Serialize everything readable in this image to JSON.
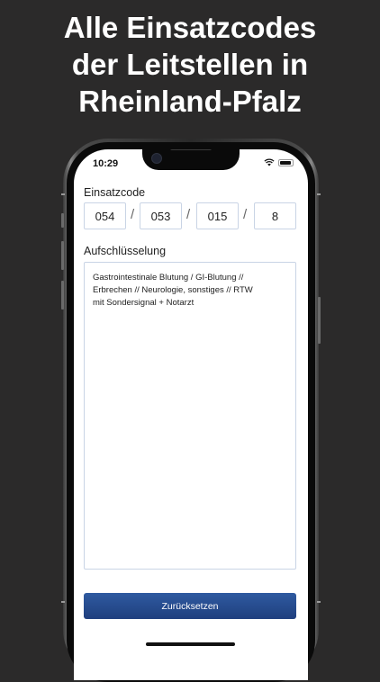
{
  "promo": {
    "headline_line1": "Alle Einsatzcodes",
    "headline_line2": "der Leitstellen in",
    "headline_line3": "Rheinland-Pfalz"
  },
  "status_bar": {
    "time": "10:29",
    "icons": [
      "wifi-icon",
      "battery-icon"
    ]
  },
  "form": {
    "code_label": "Einsatzcode",
    "code_parts": [
      "054",
      "053",
      "015",
      "8"
    ],
    "separator": "/",
    "breakdown_label": "Aufschlüsselung",
    "breakdown_text": "Gastrointestinale Blutung / GI-Blutung //\nErbrechen // Neurologie, sonstiges // RTW\nmit Sondersignal + Notarzt",
    "reset_button": "Zurücksetzen"
  },
  "colors": {
    "background": "#2b2a2a",
    "accent": "#2a4d8f",
    "field_border": "#c9d4e5"
  }
}
